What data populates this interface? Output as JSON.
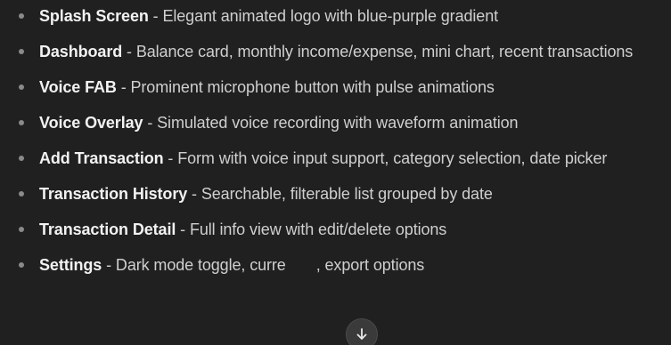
{
  "features": [
    {
      "title": "Splash Screen",
      "desc": "Elegant animated logo with blue-purple gradient"
    },
    {
      "title": "Dashboard",
      "desc": "Balance card, monthly income/expense, mini chart, recent transactions"
    },
    {
      "title": "Voice FAB",
      "desc": "Prominent microphone button with pulse animations"
    },
    {
      "title": "Voice Overlay",
      "desc": "Simulated voice recording with waveform animation"
    },
    {
      "title": "Add Transaction",
      "desc": "Form with voice input support, category selection, date picker"
    },
    {
      "title": "Transaction History",
      "desc": "Searchable, filterable list grouped by date"
    },
    {
      "title": "Transaction Detail",
      "desc": "Full info view with edit/delete options"
    },
    {
      "title": "Settings",
      "desc": "Dark mode toggle, curre"
    }
  ],
  "separator": " - ",
  "settings_tail": ", export options",
  "scroll_button": {
    "icon": "arrow-down-icon"
  }
}
